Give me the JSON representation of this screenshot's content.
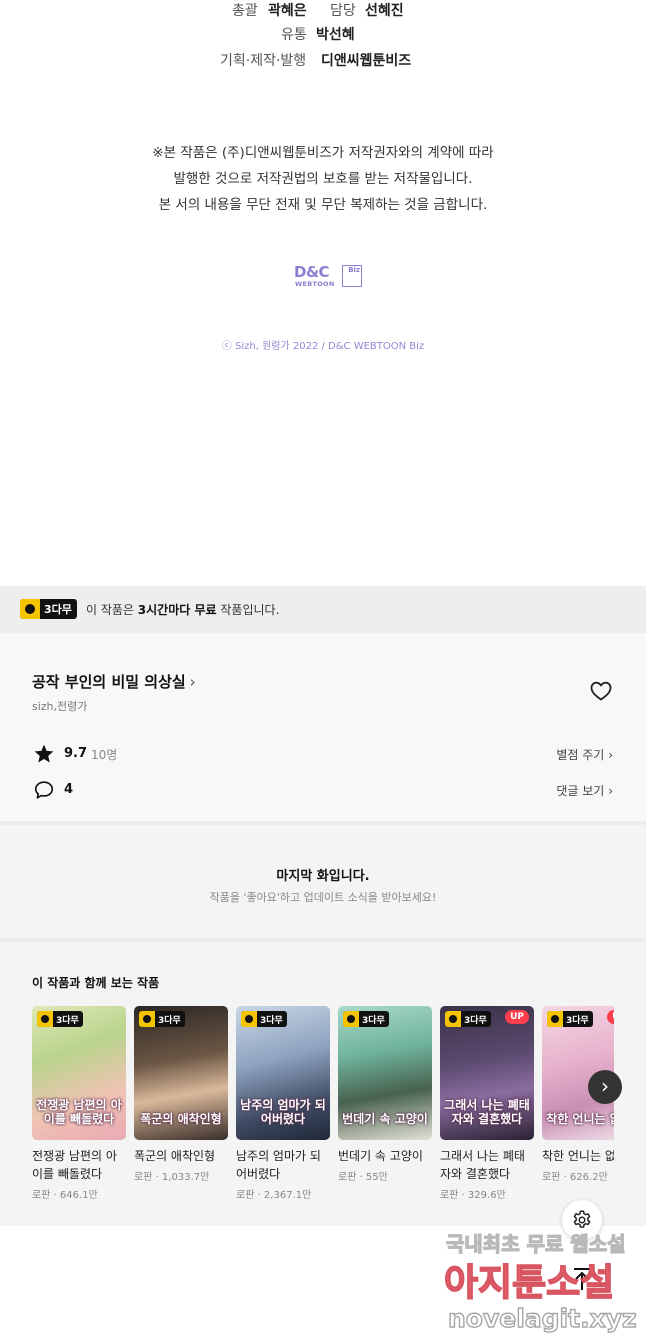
{
  "credits": {
    "rows": [
      {
        "pairs": [
          {
            "label": "총괄",
            "value": "곽혜은"
          },
          {
            "label": "담당",
            "value": "선혜진"
          }
        ]
      },
      {
        "pairs": [
          {
            "label": "유통",
            "value": "박선혜"
          }
        ]
      },
      {
        "pairs": [
          {
            "label": "기획·제작·발행",
            "value": "디앤씨웹툰비즈"
          }
        ]
      }
    ],
    "notice_lines": [
      "※본 작품은 (주)디앤씨웹툰비즈가 저작권자와의 계약에 따라",
      "발행한 것으로 저작권법의 보호를 받는 저작물입니다.",
      "본 서의 내용을 무단 전재 및 무단 복제하는 것을 금합니다."
    ],
    "logo": {
      "main": "D&C",
      "sub": "WEBTOON",
      "biz": "Biz"
    },
    "copyright": "ⓒ Sizh, 원령가 2022 / D&C WEBTOON Biz"
  },
  "free_banner": {
    "badge": "3다무",
    "text_pre": "이 작품은 ",
    "text_bold": "3시간마다 무료",
    "text_post": " 작품입니다."
  },
  "work": {
    "title": "공작 부인의 비밀 의상실",
    "author": "sizh,전령가",
    "rating": "9.7",
    "rating_count": "10명",
    "rate_link": "별점 주기",
    "comments": "4",
    "comment_link": "댓글 보기"
  },
  "last_episode": {
    "title": "마지막 화입니다.",
    "sub": "작품을 '좋아요'하고 업데이트 소식을 받아보세요!"
  },
  "recommendations": {
    "heading": "이 작품과 함께 보는 작품",
    "items": [
      {
        "name": "전쟁광 남편의 아이를 빼돌렸다",
        "meta": "로판 · 646.1만",
        "badge": "3다무",
        "up": "",
        "caption": "전쟁광 남편의 아이를 빼돌렸다"
      },
      {
        "name": "폭군의 애착인형",
        "meta": "로판 · 1,033.7만",
        "badge": "3다무",
        "up": "",
        "caption": "폭군의 애착인형"
      },
      {
        "name": "남주의 엄마가 되어버렸다",
        "meta": "로판 · 2,367.1만",
        "badge": "3다무",
        "up": "",
        "caption": "남주의 엄마가 되어버렸다"
      },
      {
        "name": "번데기 속 고양이",
        "meta": "로판 · 55만",
        "badge": "3다무",
        "up": "",
        "caption": "번데기 속 고양이"
      },
      {
        "name": "그래서 나는 폐태자와 결혼했다",
        "meta": "로판 · 329.6만",
        "badge": "3다무",
        "up": "UP",
        "caption": "그래서 나는 폐태자와 결혼했다"
      },
      {
        "name": "착한 언니는 없다",
        "meta": "로판 · 626.2만",
        "badge": "3다무",
        "up": "UP",
        "caption": "착한 언니는 없다"
      }
    ]
  },
  "watermark": {
    "line1_a": "국내최초 무료 ",
    "line1_b": "웹소설",
    "line2": "아지툰소설",
    "line3": "novelagit.xyz"
  },
  "colors": {
    "accent_yellow": "#f5c400",
    "up_red": "#ff3e4d",
    "logo_purple": "#8a7fd0"
  },
  "icons": {
    "heart": "heart-icon",
    "star": "star-icon",
    "comment": "comment-icon",
    "gear": "gear-icon",
    "next": "chevron-right-icon",
    "top": "arrow-up-icon"
  }
}
